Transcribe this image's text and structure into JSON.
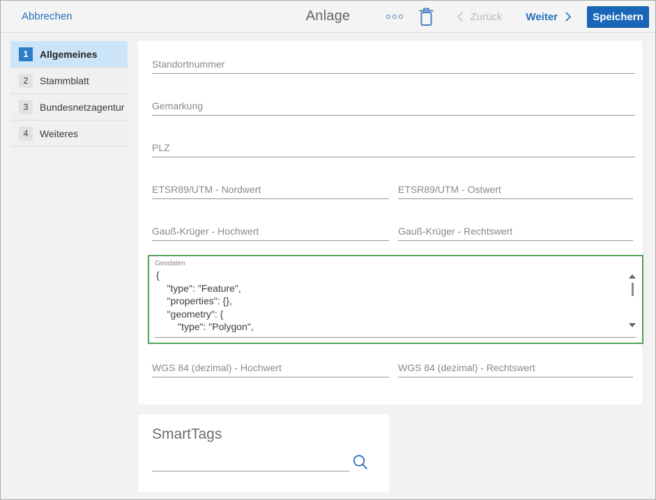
{
  "topbar": {
    "cancel_label": "Abbrechen",
    "title": "Anlage",
    "back_label": "Zurück",
    "next_label": "Weiter",
    "save_label": "Speichern",
    "icons": [
      "more-options-icon",
      "trash-icon",
      "chevron-left-icon",
      "chevron-right-icon"
    ]
  },
  "sidebar": {
    "items": [
      {
        "num": "1",
        "label": "Allgemeines",
        "active": true
      },
      {
        "num": "2",
        "label": "Stammblatt",
        "active": false
      },
      {
        "num": "3",
        "label": "Bundesnetzagentur",
        "active": false
      },
      {
        "num": "4",
        "label": "Weiteres",
        "active": false
      }
    ]
  },
  "form": {
    "standortnummer": {
      "label": "Standortnummer",
      "value": ""
    },
    "gemarkung": {
      "label": "Gemarkung",
      "value": ""
    },
    "plz": {
      "label": "PLZ",
      "value": ""
    },
    "etsr_nordwert": {
      "label": "ETSR89/UTM - Nordwert",
      "value": ""
    },
    "etsr_ostwert": {
      "label": "ETSR89/UTM - Ostwert",
      "value": ""
    },
    "gk_hochwert": {
      "label": "Gauß-Krüger - Hochwert",
      "value": ""
    },
    "gk_rechtswert": {
      "label": "Gauß-Krüger - Rechtswert",
      "value": ""
    },
    "geodaten": {
      "label": "Geodaten",
      "value": "{\n    \"type\": \"Feature\",\n    \"properties\": {},\n    \"geometry\": {\n        \"type\": \"Polygon\",",
      "focused": true
    },
    "wgs_hochwert": {
      "label": "WGS 84 (dezimal) - Hochwert",
      "value": ""
    },
    "wgs_rechtswert": {
      "label": "WGS 84 (dezimal) - Rechtswert",
      "value": ""
    }
  },
  "smarttags": {
    "title": "SmartTags",
    "search_value": "",
    "icon": "search-icon"
  },
  "colors": {
    "accent_link": "#2570bb",
    "icon_blue": "#4e82c4",
    "save_button": "#1a66b8",
    "focus_border_green": "#55a255",
    "active_step_bg": "#cce4f7",
    "active_badge": "#2e7cc8",
    "label_gray": "#8a8886",
    "disabled_gray": "#b9b9b9",
    "page_bg": "#f2f2f2"
  }
}
